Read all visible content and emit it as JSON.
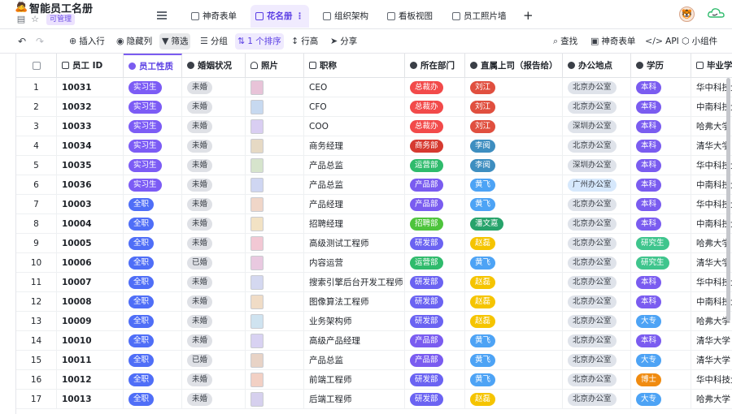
{
  "app": {
    "title": "智能员工名册",
    "logo_icon": "🙇",
    "permission": "可管理"
  },
  "tabs": [
    {
      "label": "神奇表单",
      "active": false
    },
    {
      "label": "花名册 ⋮",
      "active": true
    },
    {
      "label": "组织架构",
      "active": false
    },
    {
      "label": "看板视图",
      "active": false
    },
    {
      "label": "员工照片墙",
      "active": false
    }
  ],
  "toolbar": {
    "insert": "插入行",
    "hide": "隐藏列",
    "filter": "筛选",
    "group": "分组",
    "sort": "1 个排序",
    "row_height": "行高",
    "share": "分享",
    "find": "查找",
    "form": "神奇表单",
    "api": "API",
    "widget": "小组件"
  },
  "columns": [
    "员工 ID",
    "员工性质",
    "婚姻状况",
    "照片",
    "职称",
    "所在部门",
    "直属上司（报告给）",
    "办公地点",
    "学历",
    "毕业学"
  ],
  "rows": [
    {
      "idx": "1",
      "id": "10031",
      "type": "实习生",
      "marital": "未婚",
      "title": "CEO",
      "dept": "总裁办",
      "boss": "刘江",
      "office": "北京办公室",
      "edu": "本科",
      "school": "华中科技大学",
      "photo": "#e8c3d8"
    },
    {
      "idx": "2",
      "id": "10032",
      "type": "实习生",
      "marital": "未婚",
      "title": "CFO",
      "dept": "总裁办",
      "boss": "刘江",
      "office": "北京办公室",
      "edu": "本科",
      "school": "中南科技大学",
      "photo": "#c7d9f0"
    },
    {
      "idx": "3",
      "id": "10033",
      "type": "实习生",
      "marital": "未婚",
      "title": "COO",
      "dept": "总裁办",
      "boss": "刘江",
      "office": "深圳办公室",
      "edu": "本科",
      "school": "哈弗大学",
      "photo": "#d9cef2"
    },
    {
      "idx": "4",
      "id": "10034",
      "type": "实习生",
      "marital": "未婚",
      "title": "商务经理",
      "dept": "商务部",
      "boss": "李阅",
      "office": "北京办公室",
      "edu": "本科",
      "school": "清华大学",
      "photo": "#e6d9c4"
    },
    {
      "idx": "5",
      "id": "10035",
      "type": "实习生",
      "marital": "未婚",
      "title": "产品总监",
      "dept": "运营部",
      "boss": "李阅",
      "office": "深圳办公室",
      "edu": "本科",
      "school": "华中科技大学",
      "photo": "#d6e4cc"
    },
    {
      "idx": "6",
      "id": "10036",
      "type": "实习生",
      "marital": "未婚",
      "title": "产品总监",
      "dept": "产品部",
      "boss": "黄飞",
      "office": "广州办公室",
      "edu": "本科",
      "school": "中南科技大学",
      "photo": "#cfd6f2"
    },
    {
      "idx": "7",
      "id": "10003",
      "type": "全职",
      "marital": "未婚",
      "title": "产品经理",
      "dept": "产品部",
      "boss": "黄飞",
      "office": "北京办公室",
      "edu": "本科",
      "school": "华中科技大学",
      "photo": "#f0d6c8"
    },
    {
      "idx": "8",
      "id": "10004",
      "type": "全职",
      "marital": "未婚",
      "title": "招聘经理",
      "dept": "招聘部",
      "boss": "潘文嘉",
      "office": "北京办公室",
      "edu": "本科",
      "school": "中南科技大学",
      "photo": "#f2e2c4"
    },
    {
      "idx": "9",
      "id": "10005",
      "type": "全职",
      "marital": "未婚",
      "title": "高级测试工程师",
      "dept": "研发部",
      "boss": "赵磊",
      "office": "北京办公室",
      "edu": "研究生",
      "school": "哈弗大学",
      "photo": "#f2c8d4"
    },
    {
      "idx": "10",
      "id": "10006",
      "type": "全职",
      "marital": "已婚",
      "title": "内容运营",
      "dept": "运营部",
      "boss": "黄飞",
      "office": "北京办公室",
      "edu": "研究生",
      "school": "清华大学",
      "photo": "#e9c9e0"
    },
    {
      "idx": "11",
      "id": "10007",
      "type": "全职",
      "marital": "未婚",
      "title": "搜索引擎后台开发工程师",
      "dept": "研发部",
      "boss": "赵磊",
      "office": "北京办公室",
      "edu": "本科",
      "school": "华中科技大学",
      "photo": "#d4d8f0"
    },
    {
      "idx": "12",
      "id": "10008",
      "type": "全职",
      "marital": "未婚",
      "title": "图像算法工程师",
      "dept": "研发部",
      "boss": "赵磊",
      "office": "北京办公室",
      "edu": "本科",
      "school": "中南科技大学",
      "photo": "#f0dcc6"
    },
    {
      "idx": "13",
      "id": "10009",
      "type": "全职",
      "marital": "未婚",
      "title": "业务架构师",
      "dept": "研发部",
      "boss": "赵磊",
      "office": "北京办公室",
      "edu": "大专",
      "school": "哈弗大学",
      "photo": "#cfe3f0"
    },
    {
      "idx": "14",
      "id": "10010",
      "type": "全职",
      "marital": "未婚",
      "title": "高级产品经理",
      "dept": "产品部",
      "boss": "黄飞",
      "office": "北京办公室",
      "edu": "本科",
      "school": "清华大学",
      "photo": "#d8d2f2"
    },
    {
      "idx": "15",
      "id": "10011",
      "type": "全职",
      "marital": "已婚",
      "title": "产品总监",
      "dept": "产品部",
      "boss": "黄飞",
      "office": "北京办公室",
      "edu": "大专",
      "school": "清华大学",
      "photo": "#e8d3c6"
    },
    {
      "idx": "16",
      "id": "10012",
      "type": "全职",
      "marital": "未婚",
      "title": "前端工程师",
      "dept": "研发部",
      "boss": "黄飞",
      "office": "北京办公室",
      "edu": "博士",
      "school": "华中科技大学",
      "photo": "#f2d0c4"
    },
    {
      "idx": "17",
      "id": "10013",
      "type": "全职",
      "marital": "未婚",
      "title": "后端工程师",
      "dept": "研发部",
      "boss": "赵磊",
      "office": "北京办公室",
      "edu": "大专",
      "school": "哈弗大学",
      "photo": "#d6d0ee"
    }
  ],
  "colors": {
    "accent": "#5b3fe4",
    "dept": {
      "总裁办": "p-red",
      "商务部": "p-darkred",
      "运营部": "p-green",
      "产品部": "p-purple",
      "招聘部": "p-lime",
      "研发部": "p-indigo"
    },
    "boss": {
      "刘江": "p-crimson",
      "李阅": "p-slate",
      "黄飞": "p-sky",
      "潘文嘉": "p-teal",
      "赵磊": "p-yellow"
    },
    "office": {
      "北京办公室": "p-gb",
      "深圳办公室": "p-gb",
      "广州办公室": "p-lightblue"
    },
    "edu": {
      "本科": "p-purple",
      "研究生": "p-mint",
      "大专": "p-sky",
      "博士": "p-orange"
    },
    "type": {
      "实习生": "p-intern",
      "全职": "p-full"
    }
  }
}
